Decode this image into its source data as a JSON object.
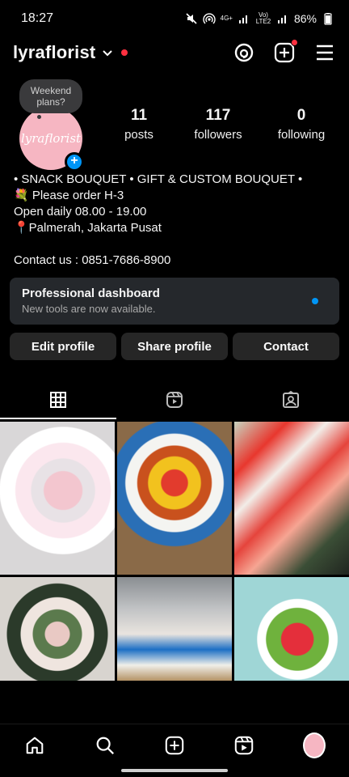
{
  "status_bar": {
    "time": "18:27",
    "network_label": "4G+",
    "lte_label": "Vo) LTE2",
    "battery": "86%"
  },
  "header": {
    "username": "lyraflorist"
  },
  "profile": {
    "note": "Weekend plans?",
    "avatar_text": "lyraflorist",
    "stats": [
      {
        "value": "11",
        "label": "posts"
      },
      {
        "value": "117",
        "label": "followers"
      },
      {
        "value": "0",
        "label": "following"
      }
    ],
    "bio": [
      "• SNACK BOUQUET • GIFT & CUSTOM BOUQUET •",
      "💐 Please order H-3",
      "Open daily 08.00 - 19.00",
      "📍Palmerah, Jakarta Pusat"
    ],
    "contact": "Contact us : 0851-7686-8900"
  },
  "dashboard": {
    "title": "Professional dashboard",
    "subtitle": "New tools are now available."
  },
  "buttons": {
    "edit": "Edit profile",
    "share": "Share profile",
    "contact": "Contact"
  },
  "tabs": [
    "grid-icon",
    "reels-icon",
    "tagged-icon"
  ],
  "colors": {
    "accent": "#0095f6",
    "notification": "#ff3040",
    "background": "#000000",
    "button": "#262626"
  }
}
